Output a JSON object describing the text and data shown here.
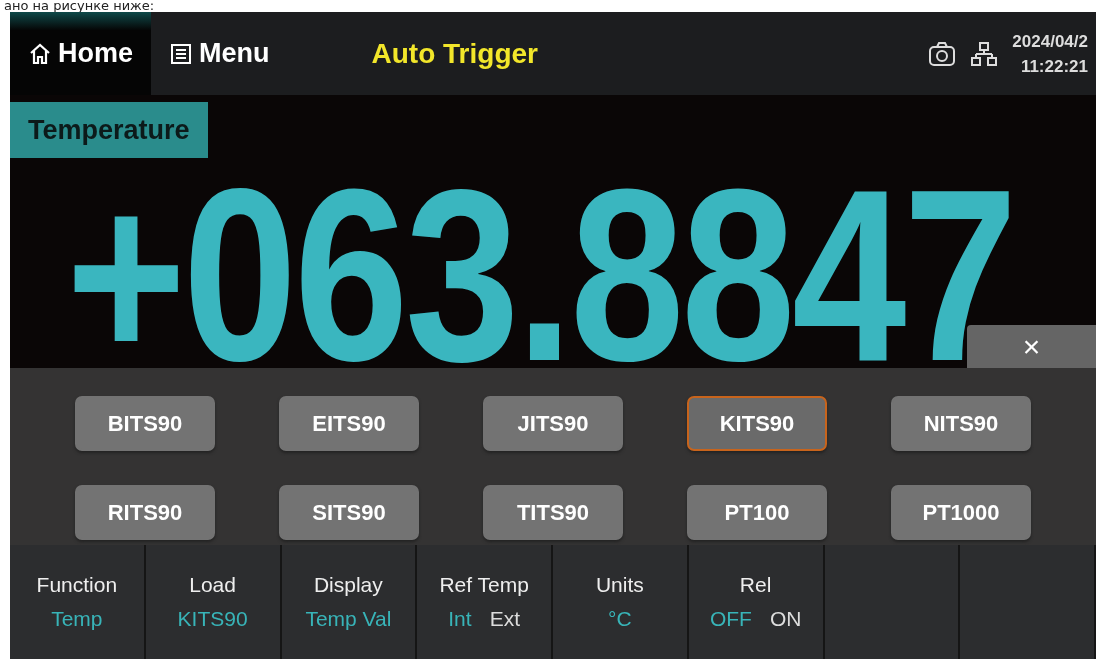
{
  "caption": "ано на рисунке ниже:",
  "header": {
    "tabs": [
      {
        "label": "Home",
        "kind": "home",
        "selected": true
      },
      {
        "label": "Menu",
        "kind": "menu",
        "selected": false
      }
    ],
    "trigger": "Auto Trigger",
    "date": "2024/04/2",
    "time": "11:22:21"
  },
  "function_tag": "Temperature",
  "reading": "+063.8847",
  "sensor_panel": {
    "close": "×",
    "options": [
      {
        "label": "BITS90",
        "selected": false
      },
      {
        "label": "EITS90",
        "selected": false
      },
      {
        "label": "JITS90",
        "selected": false
      },
      {
        "label": "KITS90",
        "selected": true
      },
      {
        "label": "NITS90",
        "selected": false
      },
      {
        "label": "RITS90",
        "selected": false
      },
      {
        "label": "SITS90",
        "selected": false
      },
      {
        "label": "TITS90",
        "selected": false
      },
      {
        "label": "PT100",
        "selected": false
      },
      {
        "label": "PT1000",
        "selected": false
      }
    ]
  },
  "softkeys": [
    {
      "label": "Function",
      "kind": "value",
      "value": "Temp"
    },
    {
      "label": "Load",
      "kind": "value",
      "value": "KITS90"
    },
    {
      "label": "Display",
      "kind": "value",
      "value": "Temp Val"
    },
    {
      "label": "Ref Temp",
      "kind": "toggle",
      "options": [
        {
          "label": "Int",
          "selected": true
        },
        {
          "label": "Ext",
          "selected": false
        }
      ]
    },
    {
      "label": "Units",
      "kind": "value",
      "value": "°C"
    },
    {
      "label": "Rel",
      "kind": "toggle",
      "options": [
        {
          "label": "OFF",
          "selected": true
        },
        {
          "label": "ON",
          "selected": false
        }
      ]
    },
    {
      "kind": "empty"
    },
    {
      "kind": "empty"
    }
  ]
}
